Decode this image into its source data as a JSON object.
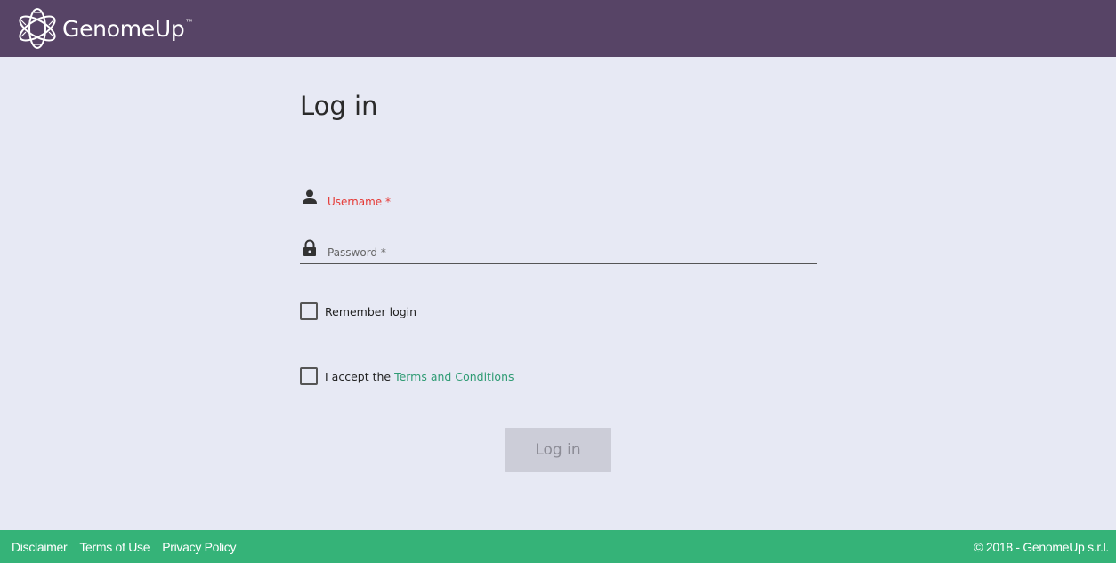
{
  "header": {
    "brand_name": "GenomeUp",
    "brand_trademark": "™",
    "background_color": "#574466"
  },
  "login_form": {
    "title": "Log in",
    "username": {
      "label": "Username *",
      "value": "",
      "icon": "person-icon"
    },
    "password": {
      "label": "Password *",
      "value": "",
      "icon": "lock-icon"
    },
    "remember_login_label": "Remember login",
    "remember_login_checked": false,
    "accept_prefix": "I accept the ",
    "terms_link_label": "Terms and Conditions",
    "accept_terms_checked": false,
    "submit_label": "Log in",
    "error_color": "#e53935",
    "link_color": "#2e9b73"
  },
  "footer": {
    "links": [
      "Disclaimer",
      "Terms of Use",
      "Privacy Policy"
    ],
    "copyright": "© 2018 - GenomeUp s.r.l.",
    "background_color": "#35b378"
  }
}
